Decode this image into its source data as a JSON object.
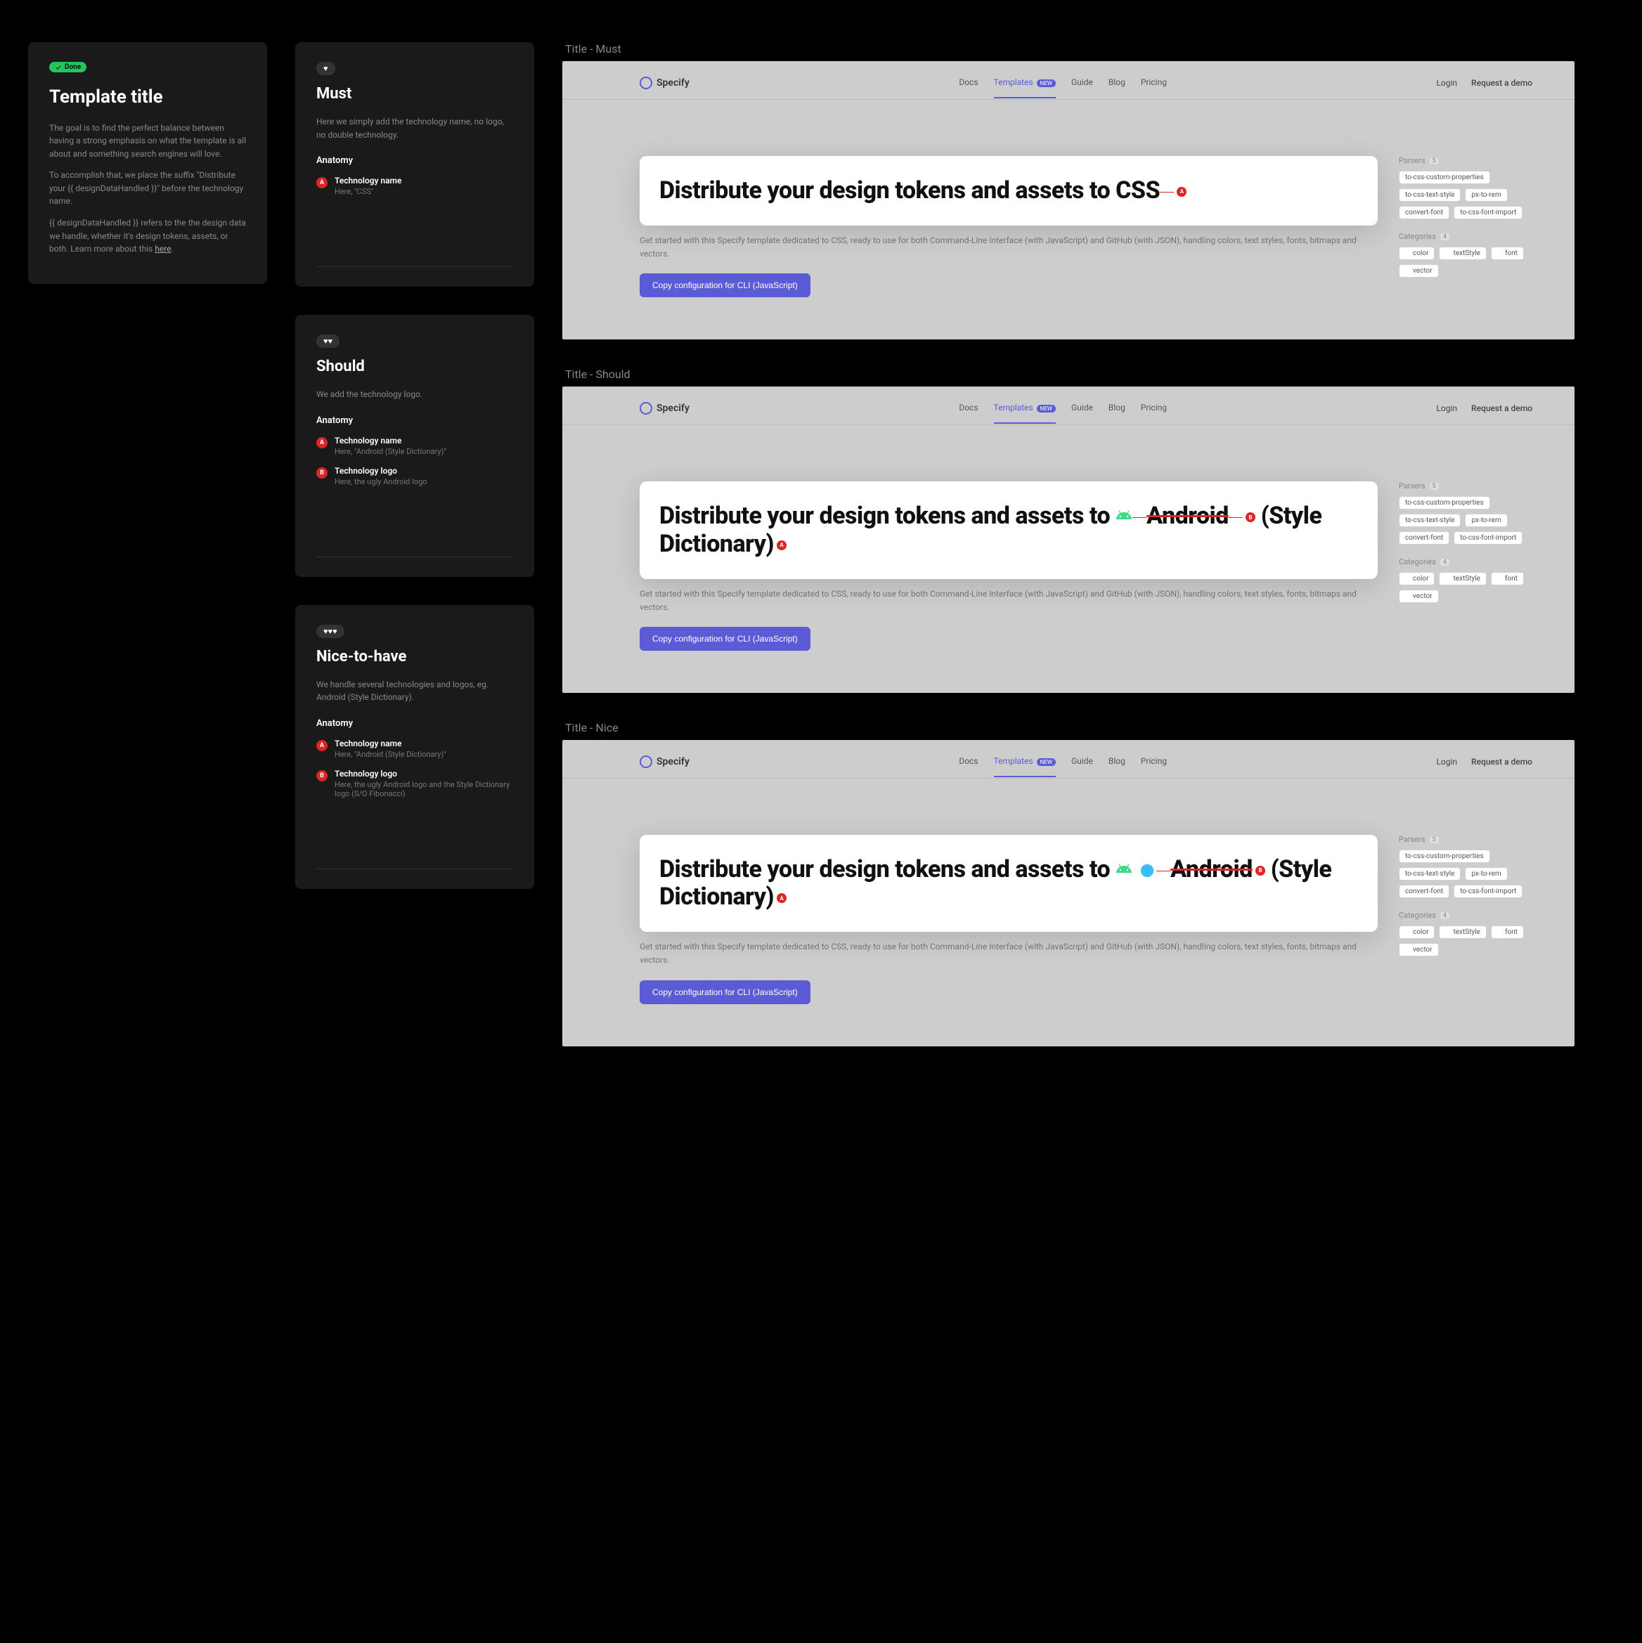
{
  "left": {
    "done_label": "Done",
    "title": "Template title",
    "para1": "The goal is to find the perfect balance between having a strong emphasis on what the template is all about and something search engines will love.",
    "para2": "To accomplish that, we place the suffix \"Distribute your {{ designDataHandled }}\" before the technology name.",
    "para3_pre": "{{ designDataHandled }} refers to the the design data we handle, whether it's design tokens, assets, or both. Learn more about this ",
    "para3_link": "here",
    "para3_post": "."
  },
  "mid": {
    "must": {
      "title": "Must",
      "intro": "Here we simply add the technology name, no logo, no double technology.",
      "anat_heading": "Anatomy",
      "items": [
        {
          "badge": "A",
          "name": "Technology name",
          "desc": "Here, \"CSS\""
        }
      ]
    },
    "should": {
      "title": "Should",
      "intro": "We add the technology logo.",
      "anat_heading": "Anatomy",
      "items": [
        {
          "badge": "A",
          "name": "Technology name",
          "desc": "Here, \"Android (Style Dictionary)\""
        },
        {
          "badge": "B",
          "name": "Technology logo",
          "desc": "Here, the ugly Android logo"
        }
      ]
    },
    "nice": {
      "title": "Nice-to-have",
      "intro": "We handle several technologies and logos, eg. Android (Style Dictionary).",
      "anat_heading": "Anatomy",
      "items": [
        {
          "badge": "A",
          "name": "Technology name",
          "desc": "Here, \"Android (Style Dictionary)\""
        },
        {
          "badge": "B",
          "name": "Technology logo",
          "desc": "Here, the ugly Android logo and the Style Dictionary logo (S/O Fibonacci)"
        }
      ]
    }
  },
  "sections": [
    {
      "label": "Title - Must",
      "headline_html": "Distribute your design tokens and assets to CSS<span class='annot-line'></span><span class='annot'>A</span>"
    },
    {
      "label": "Title - Should",
      "headline_html": "Distribute your design tokens and assets to  <svg class='android-icon' viewBox='0 0 24 24'><path fill='#3ddc84' d='M17.6 9.48l1.84-3.18c.16-.31.04-.69-.26-.85-.29-.15-.65-.06-.83.22l-1.88 3.24c-2.86-1.21-6.08-1.21-8.94 0L5.65 5.67c-.19-.29-.58-.38-.87-.2-.28.18-.37.54-.22.83L6.4 9.48C3.3 11.25 1.28 14.44 1 18h22c-.28-3.56-2.3-6.75-5.4-8.52zM7 15.25c-.69 0-1.25-.56-1.25-1.25s.56-1.25 1.25-1.25 1.25.56 1.25 1.25-.56 1.25-1.25 1.25zm10 0c-.69 0-1.25-.56-1.25-1.25s.56-1.25 1.25-1.25 1.25.56 1.25 1.25-.56 1.25-1.25 1.25z'/></svg><span class='annot-line'></span><span style='text-decoration:line-through;text-decoration-color:#dc2626'>Android</span><span class='annot-line'></span><span class='annot'>B</span> (Style Dictionary)<span class='annot'>A</span>"
    },
    {
      "label": "Title - Nice",
      "headline_html": "Distribute your design tokens and assets to  <svg class='android-icon' viewBox='0 0 24 24'><path fill='#3ddc84' d='M17.6 9.48l1.84-3.18c.16-.31.04-.69-.26-.85-.29-.15-.65-.06-.83.22l-1.88 3.24c-2.86-1.21-6.08-1.21-8.94 0L5.65 5.67c-.19-.29-.58-.38-.87-.2-.28.18-.37.54-.22.83L6.4 9.48C3.3 11.25 1.28 14.44 1 18h22c-.28-3.56-2.3-6.75-5.4-8.52zM7 15.25c-.69 0-1.25-.56-1.25-1.25s.56-1.25 1.25-1.25 1.25.56 1.25 1.25-.56 1.25-1.25 1.25zm10 0c-.69 0-1.25-.56-1.25-1.25s.56-1.25 1.25-1.25 1.25.56 1.25 1.25-.56 1.25-1.25 1.25z'/></svg> <svg class='tech-icon' width='22' height='22' viewBox='0 0 24 24'><circle cx='12' cy='12' r='10' fill='#38bdf8'/></svg><span class='annot-line'></span><span style='text-decoration:line-through;text-decoration-color:#dc2626'>Android</span><span class='annot'>B</span> (Style Dictionary)<span class='annot'>A</span>"
    }
  ],
  "preview": {
    "brand": "Specify",
    "nav": {
      "docs": "Docs",
      "templates": "Templates",
      "new_badge": "NEW",
      "guide": "Guide",
      "blog": "Blog",
      "pricing": "Pricing"
    },
    "login": "Login",
    "demo": "Request a demo",
    "desc": "Get started with this Specify template dedicated to CSS, ready to use for both Command-Line Interface (with JavaScript) and GitHub (with JSON), handling colors, text styles, fonts, bitmaps and vectors.",
    "cta": "Copy configuration for CLI (JavaScript)",
    "parsers": {
      "title": "Parsers",
      "count": "5",
      "items": [
        "to-css-custom-properties",
        "to-css-text-style",
        "px-to-rem",
        "convert-font",
        "to-css-font-import"
      ]
    },
    "categories": {
      "title": "Categories",
      "count": "4",
      "items": [
        "color",
        "textStyle",
        "font",
        "vector"
      ]
    }
  }
}
